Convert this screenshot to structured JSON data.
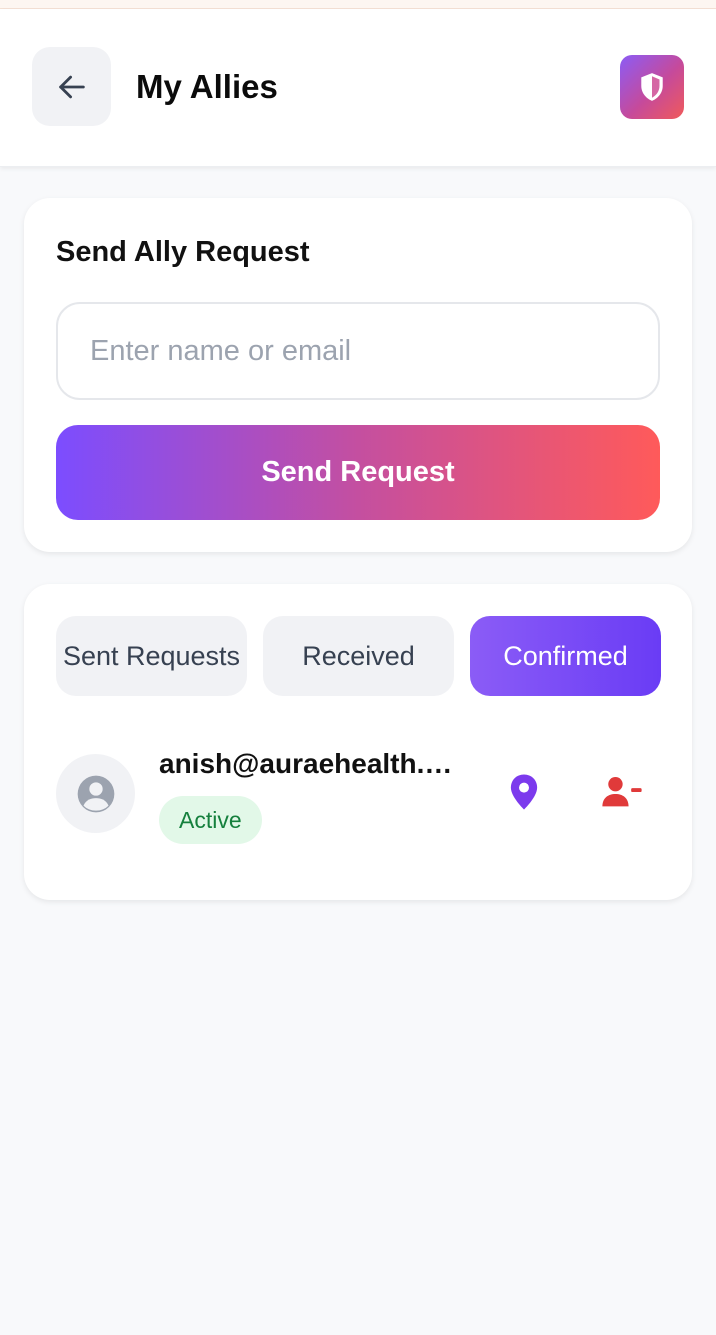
{
  "header": {
    "title": "My Allies",
    "back_icon": "arrow-left-icon",
    "badge_icon": "shield-icon"
  },
  "request_card": {
    "title": "Send Ally Request",
    "input_placeholder": "Enter name or email",
    "input_value": "",
    "button_label": "Send Request"
  },
  "tabs": [
    {
      "label": "Sent Requests",
      "active": false
    },
    {
      "label": "Received",
      "active": false
    },
    {
      "label": "Confirmed",
      "active": true
    }
  ],
  "allies": [
    {
      "email": "anish@auraehealth.…",
      "status": "Active",
      "avatar_icon": "user-icon",
      "actions": [
        "location-pin-icon",
        "remove-user-icon"
      ]
    }
  ],
  "colors": {
    "accent_purple": "#7c4dff",
    "accent_red": "#ff5a5a",
    "status_green": "#15803d",
    "remove_red": "#e03a3a",
    "location_purple": "#7c3aed"
  }
}
